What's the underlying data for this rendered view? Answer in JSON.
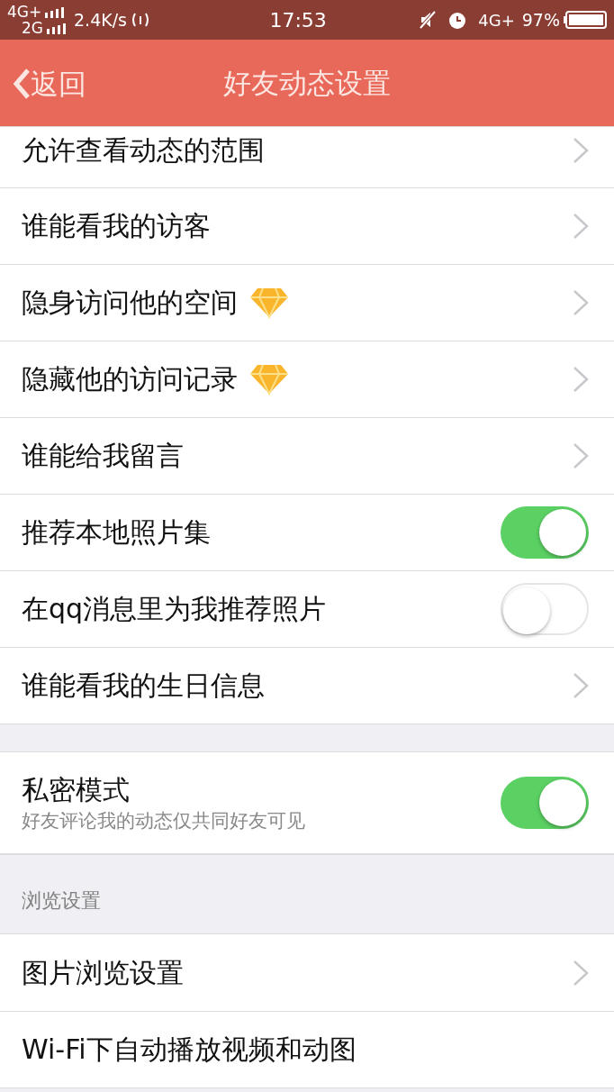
{
  "status_bar": {
    "network_1": "4G+",
    "network_2": "2G",
    "speed": "2.4K/s",
    "time": "17:53",
    "network_3": "4G+",
    "battery": "97%"
  },
  "header": {
    "back": "返回",
    "title": "好友动态设置"
  },
  "groups": [
    {
      "rows": [
        {
          "kind": "link",
          "label": "允许查看动态的范围",
          "vip": false
        },
        {
          "kind": "link",
          "label": "谁能看我的访客",
          "vip": false
        },
        {
          "kind": "link",
          "label": "隐身访问他的空间",
          "vip": true
        },
        {
          "kind": "link",
          "label": "隐藏他的访问记录",
          "vip": true
        },
        {
          "kind": "link",
          "label": "谁能给我留言",
          "vip": false
        },
        {
          "kind": "toggle",
          "label": "推荐本地照片集",
          "on": true
        },
        {
          "kind": "toggle",
          "label": "在qq消息里为我推荐照片",
          "on": false
        },
        {
          "kind": "link",
          "label": "谁能看我的生日信息",
          "vip": false
        }
      ]
    },
    {
      "rows": [
        {
          "kind": "toggle",
          "label": "私密模式",
          "subtitle": "好友评论我的动态仅共同好友可见",
          "on": true
        }
      ]
    },
    {
      "title": "浏览设置",
      "rows": [
        {
          "kind": "link",
          "label": "图片浏览设置",
          "vip": false
        },
        {
          "kind": "text",
          "label": "Wi-Fi下自动播放视频和动图"
        }
      ]
    }
  ]
}
